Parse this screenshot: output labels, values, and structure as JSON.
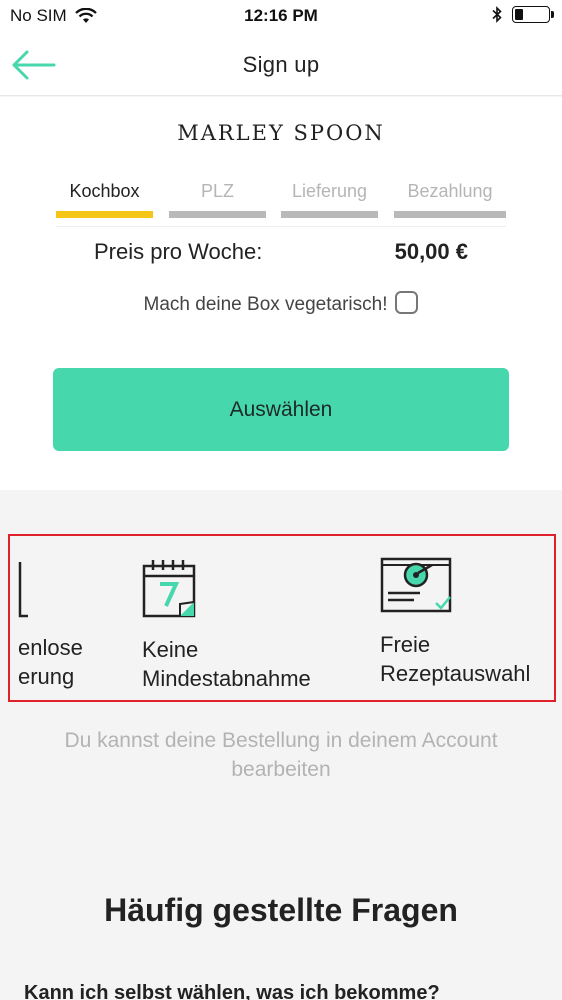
{
  "status_bar": {
    "carrier": "No SIM",
    "time": "12:16 PM",
    "battery_level": 0.25,
    "icons": [
      "wifi-icon",
      "bluetooth-icon",
      "battery-icon"
    ]
  },
  "nav": {
    "title": "Sign up",
    "back_icon": "arrow-left-icon",
    "back_color": "#47d7ac"
  },
  "logo": "MARLEY SPOON",
  "steps": [
    {
      "label": "Kochbox",
      "active": true
    },
    {
      "label": "PLZ",
      "active": false
    },
    {
      "label": "Lieferung",
      "active": false
    },
    {
      "label": "Bezahlung",
      "active": false
    }
  ],
  "price": {
    "label": "Preis pro Woche:",
    "value": "50,00 €"
  },
  "vegetarian": {
    "label": "Mach deine Box vegetarisch!",
    "checked": false
  },
  "select_button": "Auswählen",
  "features": [
    {
      "line1": "enlose",
      "line2": "erung",
      "icon": "delivery-icon"
    },
    {
      "line1": "Keine",
      "line2": "Mindestabnahme",
      "icon": "calendar-7-icon"
    },
    {
      "line1": "Freie",
      "line2": "Rezeptauswahl",
      "icon": "recipe-card-icon"
    }
  ],
  "info_text": "Du kannst deine Bestellung in deinem Account bearbeiten",
  "faq": {
    "title": "Häufig gestellte Fragen",
    "first_question": "Kann ich selbst wählen, was ich bekomme?"
  },
  "colors": {
    "accent": "#47d7ac",
    "active_step": "#f5c518",
    "inactive_step": "#b9b9b9",
    "highlight_border": "#e0212b"
  }
}
